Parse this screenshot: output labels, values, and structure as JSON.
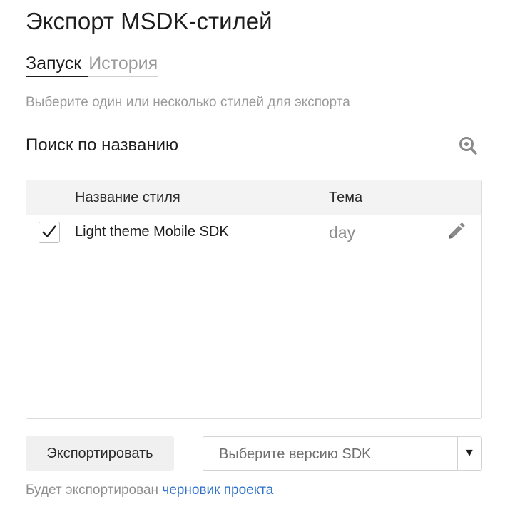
{
  "page": {
    "title": "Экспорт MSDK-стилей"
  },
  "tabs": [
    {
      "label": "Запуск",
      "active": true
    },
    {
      "label": "История",
      "active": false
    }
  ],
  "hint": "Выберите один или несколько стилей для экспорта",
  "search": {
    "placeholder": "Поиск по названию",
    "icon": "search-icon"
  },
  "table": {
    "columns": {
      "name": "Название стиля",
      "theme": "Тема"
    },
    "rows": [
      {
        "checked": true,
        "name": "Light theme Mobile SDK",
        "theme": "day",
        "icon": "pencil-icon"
      }
    ]
  },
  "actions": {
    "export_label": "Экспортировать",
    "sdk_select_placeholder": "Выберите версию SDK",
    "dropdown_arrow": "▼"
  },
  "footer": {
    "text": "Будет экспортирован",
    "link_text": "черновик проекта"
  },
  "colors": {
    "link": "#2a6fc9",
    "muted_text": "#9a9a9a",
    "header_background": "#f3f3f3",
    "button_background": "#f0f0f0"
  }
}
